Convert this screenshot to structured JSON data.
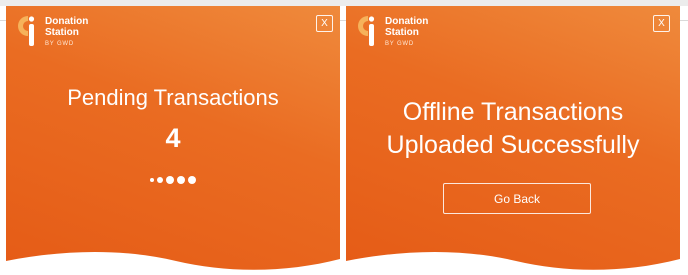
{
  "brand": {
    "line1": "Donation",
    "line2": "Station",
    "sub": "BY GWD",
    "accent": "#ea6c22",
    "mark_color": "#f4a84a"
  },
  "pending_panel": {
    "close_label": "X",
    "title": "Pending Transactions",
    "count": "4"
  },
  "upload_panel": {
    "close_label": "X",
    "title_line1": "Offline Transactions",
    "title_line2": "Uploaded Successfully",
    "button_label": "Go Back"
  }
}
